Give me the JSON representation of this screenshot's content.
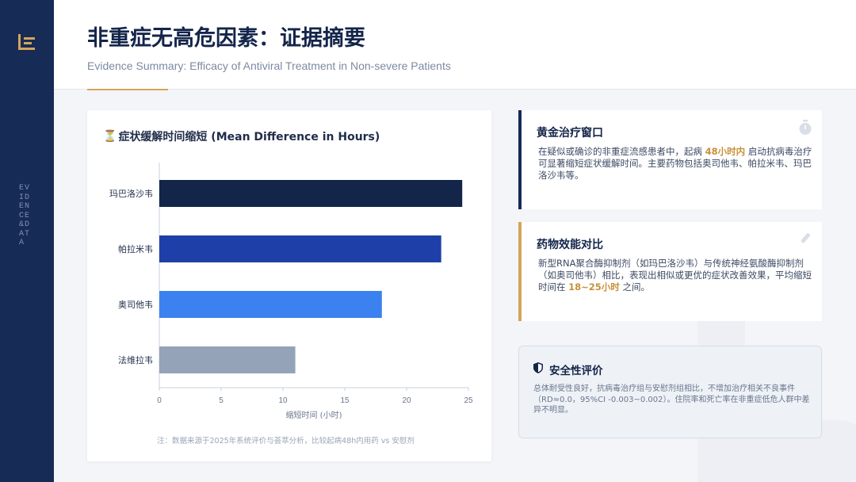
{
  "brand": {
    "vertical_label": "EVIDENCE&DATA",
    "logo_icon": "document-lines-icon"
  },
  "header": {
    "title": "非重症无高危因素：证据摘要",
    "subtitle": "Evidence Summary: Efficacy of Antiviral Treatment in Non-severe Patients"
  },
  "chart_card": {
    "title": "症状缓解时间缩短 (Mean Difference in Hours)",
    "title_icon": "hourglass-icon",
    "note": "注：数据来源于2025年系统评价与荟萃分析，比较起病48h内用药 vs 安慰剂"
  },
  "chart_data": {
    "type": "bar",
    "orientation": "horizontal",
    "title": "症状缓解时间缩短 (Mean Difference in Hours)",
    "xlabel": "缩短时间 (小时)",
    "ylabel": "",
    "xlim": [
      0,
      25
    ],
    "xticks": [
      "0",
      "5",
      "10",
      "15",
      "20",
      "25"
    ],
    "categories": [
      "玛巴洛沙韦",
      "帕拉米韦",
      "奥司他韦",
      "法维拉韦"
    ],
    "values": [
      24.5,
      22.8,
      18.0,
      11.0
    ],
    "colors": [
      "#14254a",
      "#1f3fa8",
      "#3b82f0",
      "#94a3b8"
    ],
    "grid": false
  },
  "cards": {
    "window": {
      "title": "黄金治疗窗口",
      "body_pre": "在疑似或确诊的非重症流感患者中，起病 ",
      "body_hl": "48小时内",
      "body_post": " 启动抗病毒治疗可显著缩短症状缓解时间。主要药物包括奥司他韦、帕拉米韦、玛巴洛沙韦等。",
      "icon": "stopwatch-icon"
    },
    "compare": {
      "title": "药物效能对比",
      "body_pre": "新型RNA聚合酶抑制剂（如玛巴洛沙韦）与传统神经氨酸酶抑制剂（如奥司他韦）相比，表现出相似或更优的症状改善效果，平均缩短时间在 ",
      "body_hl": "18~25小时",
      "body_post": " 之间。",
      "icon": "flask-icon"
    },
    "safety": {
      "title": "安全性评价",
      "body": "总体耐受性良好，抗病毒治疗组与安慰剂组相比，不增加治疗相关不良事件（RD≈0.0，95%CI -0.003~0.002）。住院率和死亡率在非重症低危人群中差异不明显。",
      "icon": "shield-icon"
    }
  },
  "colors": {
    "navy": "#162b55",
    "gold": "#d4a55a"
  }
}
